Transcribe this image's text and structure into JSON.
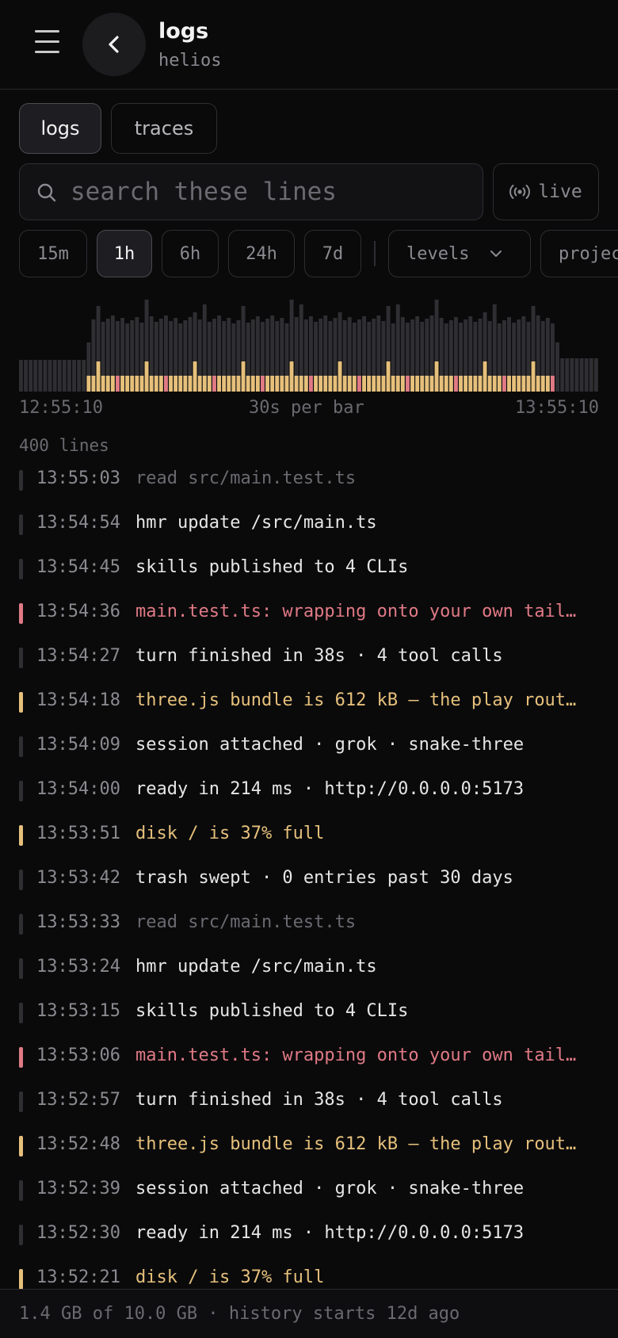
{
  "header": {
    "title": "logs",
    "subtitle": "helios",
    "menu_icon": "hamburger-menu-icon",
    "back_icon": "chevron-left-icon"
  },
  "tabs": [
    {
      "label": "logs",
      "active": true
    },
    {
      "label": "traces",
      "active": false
    }
  ],
  "search": {
    "placeholder": "search these lines",
    "value": "",
    "icon": "search-icon"
  },
  "live": {
    "label": "live",
    "icon": "broadcast-icon"
  },
  "time_ranges": [
    {
      "label": "15m",
      "active": false
    },
    {
      "label": "1h",
      "active": true
    },
    {
      "label": "6h",
      "active": false
    },
    {
      "label": "24h",
      "active": false
    },
    {
      "label": "7d",
      "active": false
    }
  ],
  "filters": {
    "levels_label": "levels",
    "project_label": "projects"
  },
  "histogram": {
    "start_label": "12:55:10",
    "center_label": "30s per bar",
    "end_label": "13:55:10",
    "bar_count": 120,
    "colors": {
      "info": "#2f2f33",
      "warn": "#e6c07b",
      "error": "#e07a85"
    }
  },
  "line_count": "400 lines",
  "colors": {
    "background": "#0a0a0b",
    "warn": "#e6c07b",
    "error": "#e07a85",
    "muted": "#8a8a90"
  },
  "logs": [
    {
      "time": "13:55:03",
      "message": "read src/main.test.ts",
      "level": "debug"
    },
    {
      "time": "13:54:54",
      "message": "hmr update /src/main.ts",
      "level": "info"
    },
    {
      "time": "13:54:45",
      "message": "skills published to 4 CLIs",
      "level": "info"
    },
    {
      "time": "13:54:36",
      "message": "main.test.ts: wrapping onto your own tail…",
      "level": "error"
    },
    {
      "time": "13:54:27",
      "message": "turn finished in 38s · 4 tool calls",
      "level": "info"
    },
    {
      "time": "13:54:18",
      "message": "three.js bundle is 612 kB — the play rout…",
      "level": "warn"
    },
    {
      "time": "13:54:09",
      "message": "session attached · grok · snake-three",
      "level": "info"
    },
    {
      "time": "13:54:00",
      "message": "ready in 214 ms · http://0.0.0.0:5173",
      "level": "info"
    },
    {
      "time": "13:53:51",
      "message": "disk / is 37% full",
      "level": "warn"
    },
    {
      "time": "13:53:42",
      "message": "trash swept · 0 entries past 30 days",
      "level": "info"
    },
    {
      "time": "13:53:33",
      "message": "read src/main.test.ts",
      "level": "debug"
    },
    {
      "time": "13:53:24",
      "message": "hmr update /src/main.ts",
      "level": "info"
    },
    {
      "time": "13:53:15",
      "message": "skills published to 4 CLIs",
      "level": "info"
    },
    {
      "time": "13:53:06",
      "message": "main.test.ts: wrapping onto your own tail…",
      "level": "error"
    },
    {
      "time": "13:52:57",
      "message": "turn finished in 38s · 4 tool calls",
      "level": "info"
    },
    {
      "time": "13:52:48",
      "message": "three.js bundle is 612 kB — the play rout…",
      "level": "warn"
    },
    {
      "time": "13:52:39",
      "message": "session attached · grok · snake-three",
      "level": "info"
    },
    {
      "time": "13:52:30",
      "message": "ready in 214 ms · http://0.0.0.0:5173",
      "level": "info"
    },
    {
      "time": "13:52:21",
      "message": "disk / is 37% full",
      "level": "warn"
    }
  ],
  "footer": {
    "storage_text": "1.4 GB of 10.0 GB · history starts 12d ago"
  }
}
